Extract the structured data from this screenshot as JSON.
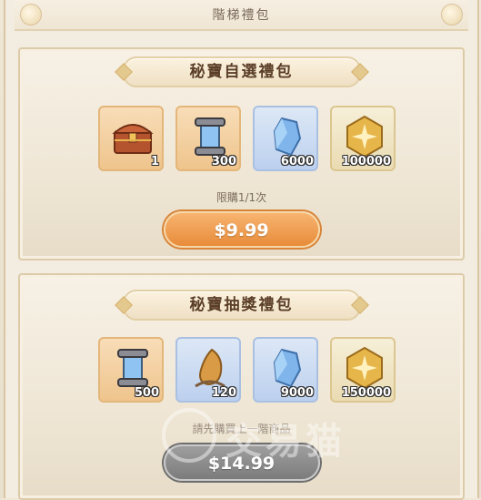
{
  "top_banner": {
    "title": "階梯禮包"
  },
  "panels": [
    {
      "title": "秘寶自選禮包",
      "items": [
        {
          "icon": "treasure-chest-icon",
          "qty": "1",
          "color": "orange"
        },
        {
          "icon": "summon-scroll-icon",
          "qty": "300",
          "color": "orange"
        },
        {
          "icon": "blue-crystal-icon",
          "qty": "6000",
          "color": "blue"
        },
        {
          "icon": "gold-coin-icon",
          "qty": "100000",
          "color": "gold"
        }
      ],
      "limit_text": "限購1/1次",
      "price": "$9.99",
      "button_state": "active"
    },
    {
      "title": "秘寶抽獎禮包",
      "items": [
        {
          "icon": "summon-scroll-icon",
          "qty": "500",
          "color": "orange"
        },
        {
          "icon": "amber-stone-icon",
          "qty": "120",
          "color": "blue"
        },
        {
          "icon": "blue-crystal-icon",
          "qty": "9000",
          "color": "blue"
        },
        {
          "icon": "gold-coin-icon",
          "qty": "150000",
          "color": "gold"
        }
      ],
      "hint_text": "請先購買上一階商品",
      "price": "$14.99",
      "button_state": "disabled"
    }
  ],
  "watermark": {
    "text": "交易猫"
  },
  "colors": {
    "button_orange": "#e88c3a",
    "button_gray": "#7c7c7c",
    "header_text": "#5b3e28"
  }
}
